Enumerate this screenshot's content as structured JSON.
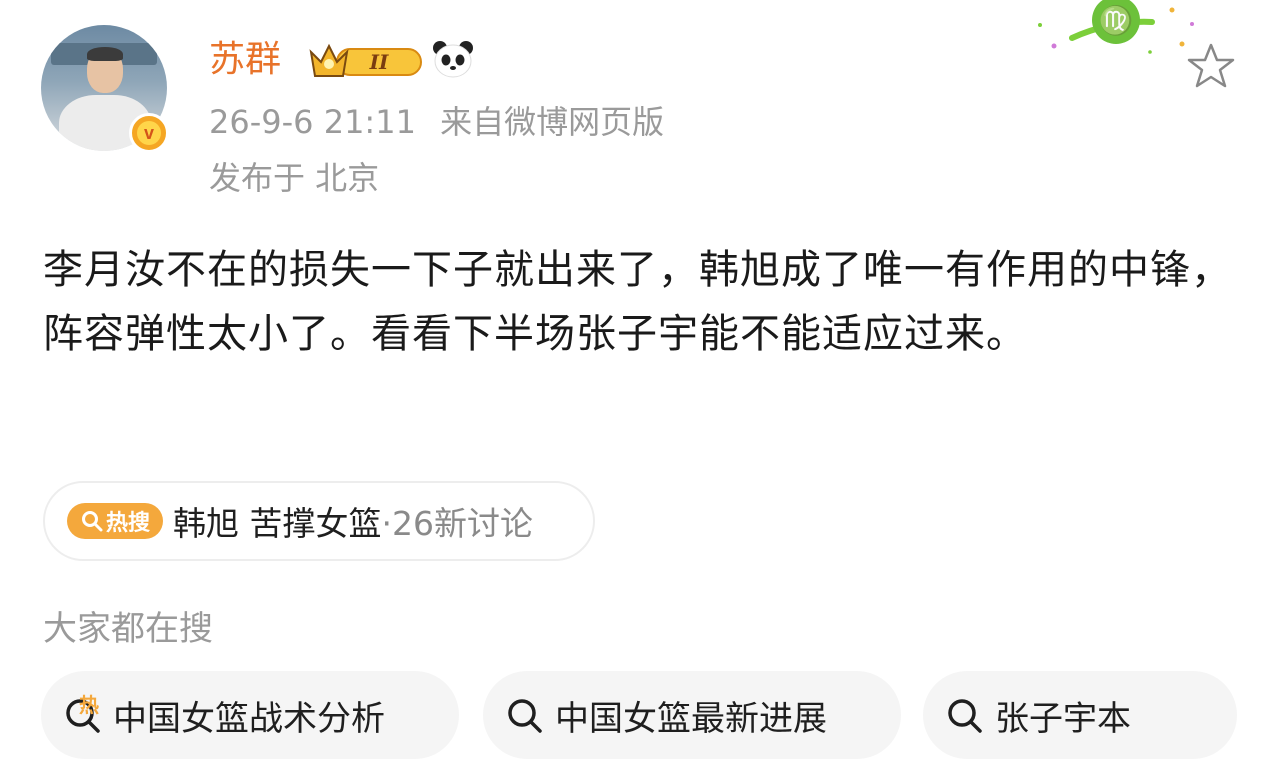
{
  "post": {
    "author": "苏群",
    "timestamp": "26-9-6 21:11",
    "source": "来自微博网页版",
    "location": "发布于 北京",
    "level_badge": "II",
    "content": "李月汝不在的损失一下子就出来了，韩旭成了唯一有作用的中锋，阵容弹性太小了。看看下半场张子宇能不能适应过来。"
  },
  "hot_search": {
    "tag_label": "热搜",
    "title": "韩旭 苦撑女篮",
    "count": "·26新讨论"
  },
  "related": {
    "title": "大家都在搜",
    "items": [
      {
        "label": "中国女篮战术分析",
        "icon": "hot-search-icon",
        "hot_mark": "热"
      },
      {
        "label": "中国女篮最新进展",
        "icon": "search-icon"
      },
      {
        "label": "张子宇本",
        "icon": "search-icon"
      }
    ]
  },
  "icons": {
    "verified": "verified-v-icon",
    "crown": "crown-level-icon",
    "panda": "panda-icon",
    "zodiac": "virgo-zodiac-icon",
    "favorite": "star-outline-icon"
  },
  "colors": {
    "username": "#e8732a",
    "hot_tag": "#f4a83c",
    "meta": "#9a9a9a",
    "pill_bg": "#f5f5f5"
  }
}
